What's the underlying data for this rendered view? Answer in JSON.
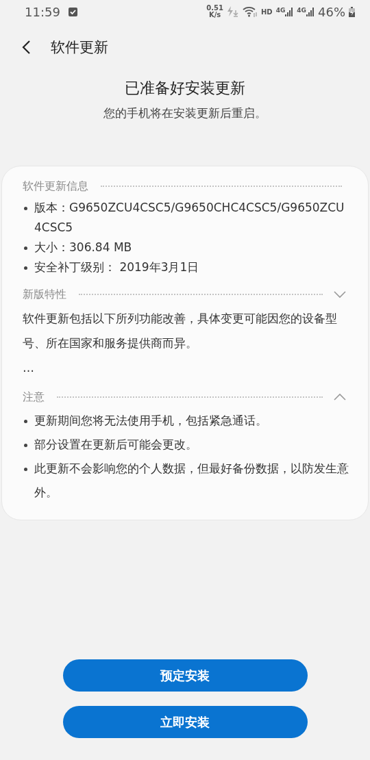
{
  "status_bar": {
    "time": "11:59",
    "net_speed": "0.51",
    "net_unit": "K/s",
    "hd": "HD",
    "networks": [
      "4G",
      "4G"
    ],
    "battery": "46%"
  },
  "header": {
    "title": "软件更新"
  },
  "intro": {
    "title": "已准备好安装更新",
    "subtitle": "您的手机将在安装更新后重启。"
  },
  "sections": [
    {
      "kind": "plain",
      "title": "软件更新信息",
      "bullets": [
        "版本：G9650ZCU4CSC5/G9650CHC4CSC5/G9650ZCU4CSC5",
        "大小：306.84 MB",
        "安全补丁级别： 2019年3月1日"
      ]
    },
    {
      "kind": "collapsible",
      "title": "新版特性",
      "expanded": false,
      "paragraphs": [
        "软件更新包括以下所列功能改善，具体变更可能因您的设备型号、所在国家和服务提供商而异。",
        "…"
      ]
    },
    {
      "kind": "collapsible",
      "title": "注意",
      "expanded": true,
      "bullets": [
        "更新期间您将无法使用手机，包括紧急通话。",
        "部分设置在更新后可能会更改。",
        "此更新不会影响您的个人数据，但最好备份数据，以防发生意外。"
      ]
    }
  ],
  "buttons": [
    "预定安装",
    "立即安装"
  ]
}
